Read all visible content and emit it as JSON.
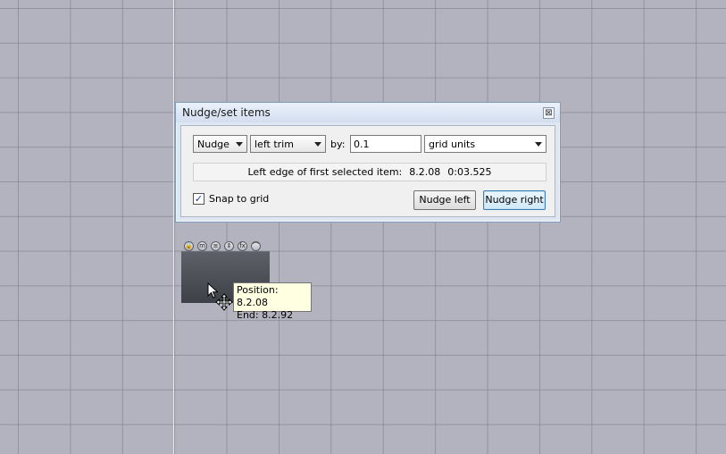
{
  "dialog": {
    "title": "Nudge/set items",
    "close_glyph": "⊠",
    "mode": "Nudge",
    "target": "left trim",
    "by_label": "by:",
    "amount": "0.1",
    "units": "grid units",
    "info_label": "Left edge of first selected item:",
    "info_position": "8.2.08",
    "info_time": "0:03.525",
    "snap_label": "Snap to grid",
    "snap_checked": true,
    "nudge_left_label": "Nudge left",
    "nudge_right_label": "Nudge right"
  },
  "tooltip": {
    "position_line": "Position: 8.2.08",
    "end_line": "End: 8.2.92"
  },
  "item_buttons": [
    {
      "icon": "lock-icon",
      "glyph": "🔒"
    },
    {
      "icon": "mute-icon",
      "glyph": "m"
    },
    {
      "icon": "properties-icon",
      "glyph": "≡"
    },
    {
      "icon": "take-icon",
      "glyph": "⇕"
    },
    {
      "icon": "fx-icon",
      "glyph": "fx"
    },
    {
      "icon": "envelope-icon",
      "glyph": "⌒"
    }
  ],
  "colors": {
    "grid_background": "#b3b3bf",
    "media_item": "#4d4f56",
    "tooltip": "#ffffe1",
    "dialog_frame": "#dde6f1"
  }
}
